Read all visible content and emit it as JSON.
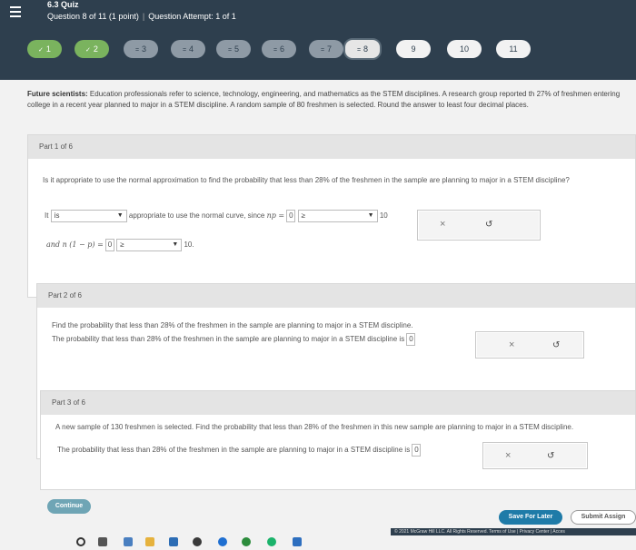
{
  "header": {
    "quiz_title": "6.3 Quiz",
    "question_label": "Question 8 of 11 (1 point)",
    "attempt_label": "Question Attempt: 1 of 1"
  },
  "nav": {
    "items": [
      {
        "label": "1",
        "state": "correct",
        "mark": "✓"
      },
      {
        "label": "2",
        "state": "correct",
        "mark": "✓"
      },
      {
        "label": "3",
        "state": "partial",
        "mark": "="
      },
      {
        "label": "4",
        "state": "partial",
        "mark": "="
      },
      {
        "label": "5",
        "state": "partial",
        "mark": "="
      },
      {
        "label": "6",
        "state": "partial",
        "mark": "="
      },
      {
        "label": "7",
        "state": "partial",
        "mark": "="
      },
      {
        "label": "8",
        "state": "current",
        "mark": "="
      },
      {
        "label": "9",
        "state": "open",
        "mark": ""
      },
      {
        "label": "10",
        "state": "open",
        "mark": ""
      },
      {
        "label": "11",
        "state": "open",
        "mark": ""
      }
    ]
  },
  "intro": {
    "lead": "Future scientists:",
    "text": " Education professionals refer to science, technology, engineering, and mathematics as the STEM disciplines. A research group reported th 27% of freshmen entering college in a recent year planned to major in a STEM discipline. A random sample of 80 freshmen is selected. Round the answer to least four decimal places."
  },
  "part1": {
    "header": "Part 1 of 6",
    "question": "Is it appropriate to use the normal approximation to find the probability that less than 28% of the freshmen in the sample are planning to major in a STEM discipline?",
    "it_label": "It",
    "is_select": "is",
    "appropriate_text": "appropriate to use the normal curve, since",
    "np_label": "np =",
    "np_value": "0",
    "cmp1": "≥",
    "ten1": "10",
    "and_label": "and n (1 − p) =",
    "nq_value": "0",
    "cmp2": "≥",
    "ten2": "10."
  },
  "part2": {
    "header": "Part 2 of 6",
    "question": "Find the probability that less than 28% of the freshmen in the sample are planning to major in a STEM discipline.",
    "answer_text": "The probability that less than 28% of the freshmen in the sample are planning to major in a STEM discipline is",
    "answer_value": "0"
  },
  "part3": {
    "header": "Part 3 of 6",
    "question": "A new sample of 130 freshmen is selected. Find the probability that less than 28% of the freshmen in this new sample are planning to major in a STEM discipline.",
    "answer_text": "The probability that less than 28% of the freshmen in the sample are planning to major in a STEM discipline is",
    "answer_value": "0"
  },
  "buttons": {
    "clear": "×",
    "redo": "↺",
    "continue": "Continue",
    "save": "Save For Later",
    "submit": "Submit Assign"
  },
  "legal": "© 2021 McGraw Hill LLC. All Rights Reserved.   Terms of Use  |  Privacy Center  |  Acces",
  "colors": {
    "header_bg": "#2e3f4e",
    "correct": "#7ab35e",
    "primary": "#1f7ba8"
  }
}
